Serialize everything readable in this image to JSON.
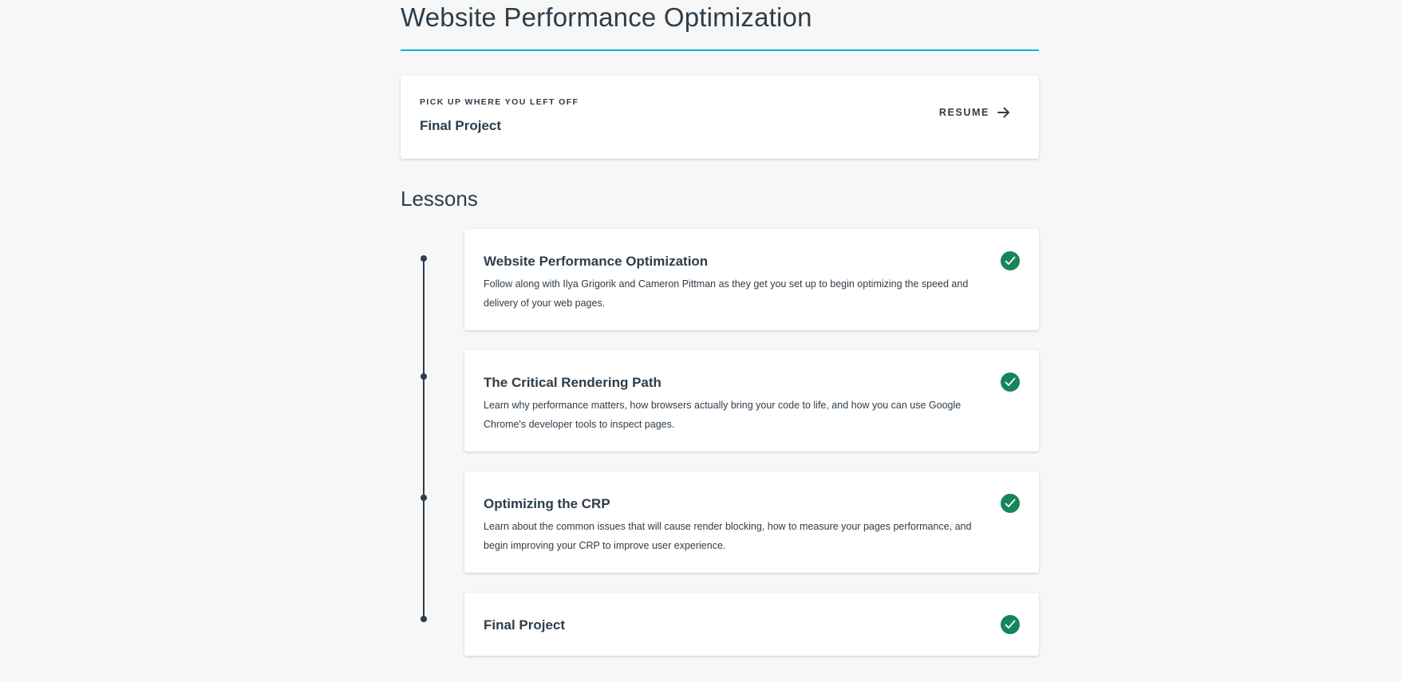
{
  "page": {
    "title": "Website Performance Optimization"
  },
  "resume": {
    "kicker": "PICK UP WHERE YOU LEFT OFF",
    "lesson": "Final Project",
    "button_label": "RESUME",
    "button_icon": "arrow-right-icon"
  },
  "lessons": {
    "heading": "Lessons",
    "items": [
      {
        "title": "Website Performance Optimization",
        "description": "Follow along with Ilya Grigorik and Cameron Pittman as they get you set up to begin optimizing the speed and delivery of your web pages.",
        "status": "completed",
        "icon": "check-circle-icon"
      },
      {
        "title": "The Critical Rendering Path",
        "description": "Learn why performance matters, how browsers actually bring your code to life, and how you can use Google Chrome's developer tools to inspect pages.",
        "status": "completed",
        "icon": "check-circle-icon"
      },
      {
        "title": "Optimizing the CRP",
        "description": "Learn about the common issues that will cause render blocking, how to measure your pages performance, and begin improving your CRP to improve user experience.",
        "status": "completed",
        "icon": "check-circle-icon"
      },
      {
        "title": "Final Project",
        "description": "",
        "status": "completed",
        "icon": "check-circle-icon"
      }
    ]
  },
  "colors": {
    "accent_rule": "#02b3e4",
    "completed": "#15855a",
    "text": "#2e3d49",
    "background": "#f7f7f7"
  }
}
